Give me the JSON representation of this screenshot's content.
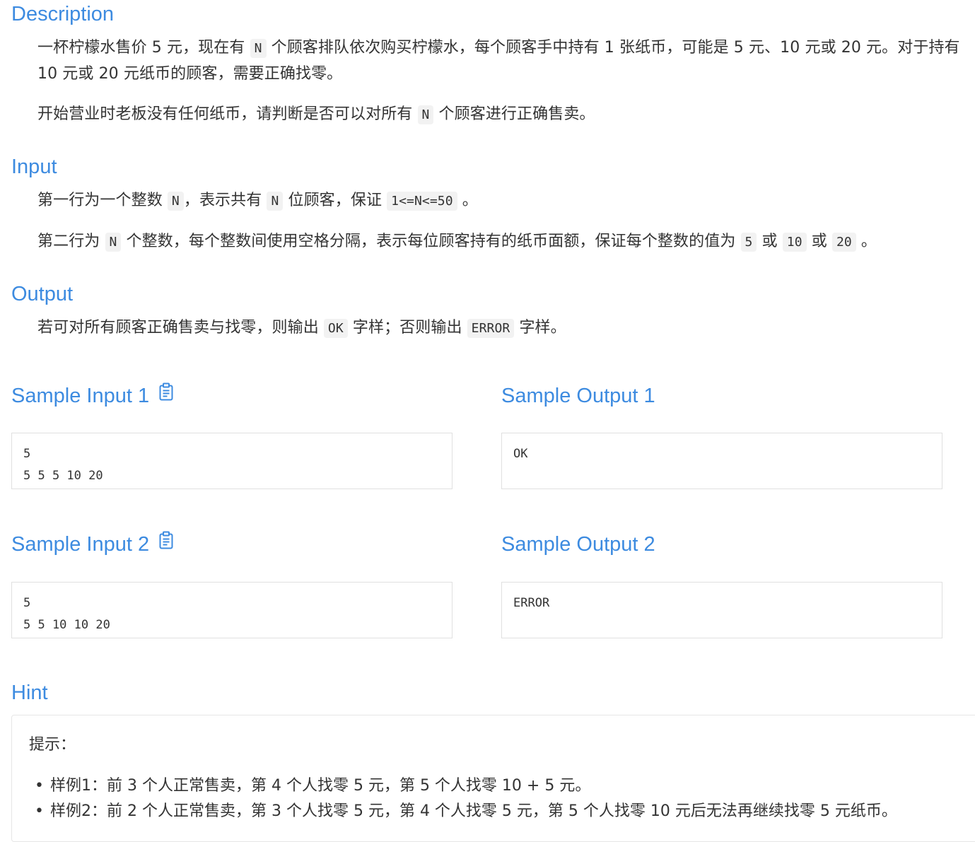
{
  "description": {
    "title": "Description",
    "p1": [
      {
        "t": "text",
        "v": "一杯柠檬水售价 5 元，现在有 "
      },
      {
        "t": "code",
        "v": "N"
      },
      {
        "t": "text",
        "v": " 个顾客排队依次购买柠檬水，每个顾客手中持有 1 张纸币，可能是 5 元、10 元或 20 元。对于持有 10 元或 20 元纸币的顾客，需要正确找零。"
      }
    ],
    "p2": [
      {
        "t": "text",
        "v": "开始营业时老板没有任何纸币，请判断是否可以对所有 "
      },
      {
        "t": "code",
        "v": "N"
      },
      {
        "t": "text",
        "v": " 个顾客进行正确售卖。"
      }
    ]
  },
  "input": {
    "title": "Input",
    "p1": [
      {
        "t": "text",
        "v": "第一行为一个整数 "
      },
      {
        "t": "code",
        "v": "N"
      },
      {
        "t": "text",
        "v": "，表示共有 "
      },
      {
        "t": "code",
        "v": "N"
      },
      {
        "t": "text",
        "v": " 位顾客，保证 "
      },
      {
        "t": "code",
        "v": "1<=N<=50"
      },
      {
        "t": "text",
        "v": " 。"
      }
    ],
    "p2": [
      {
        "t": "text",
        "v": "第二行为 "
      },
      {
        "t": "code",
        "v": "N"
      },
      {
        "t": "text",
        "v": " 个整数，每个整数间使用空格分隔，表示每位顾客持有的纸币面额，保证每个整数的值为 "
      },
      {
        "t": "code",
        "v": "5"
      },
      {
        "t": "text",
        "v": " 或 "
      },
      {
        "t": "code",
        "v": "10"
      },
      {
        "t": "text",
        "v": " 或 "
      },
      {
        "t": "code",
        "v": "20"
      },
      {
        "t": "text",
        "v": " 。"
      }
    ]
  },
  "output": {
    "title": "Output",
    "p1": [
      {
        "t": "text",
        "v": "若可对所有顾客正确售卖与找零，则输出 "
      },
      {
        "t": "code",
        "v": "OK"
      },
      {
        "t": "text",
        "v": " 字样；否则输出 "
      },
      {
        "t": "code",
        "v": "ERROR"
      },
      {
        "t": "text",
        "v": " 字样。"
      }
    ]
  },
  "samples": [
    {
      "input_title": "Sample Input 1",
      "output_title": "Sample Output 1",
      "input_lines": [
        "5",
        "5 5 5 10 20"
      ],
      "output_lines": [
        "OK"
      ]
    },
    {
      "input_title": "Sample Input 2",
      "output_title": "Sample Output 2",
      "input_lines": [
        "5",
        "5 5 10 10 20"
      ],
      "output_lines": [
        "ERROR"
      ]
    }
  ],
  "copy_icon": "clipboard-icon",
  "hint": {
    "title": "Hint",
    "lead": "提示：",
    "items": [
      "样例1：前 3 个人正常售卖，第 4 个人找零 5 元，第 5 个人找零 10 + 5 元。",
      "样例2：前 2 个人正常售卖，第 3 个人找零 5 元，第 4 个人找零 5 元，第 5 个人找零 10 元后无法再继续找零 5 元纸币。"
    ]
  },
  "colors": {
    "heading": "#3d8be0",
    "text": "#333333",
    "code_bg": "#f2f2f2",
    "border": "#e0e0e0"
  }
}
